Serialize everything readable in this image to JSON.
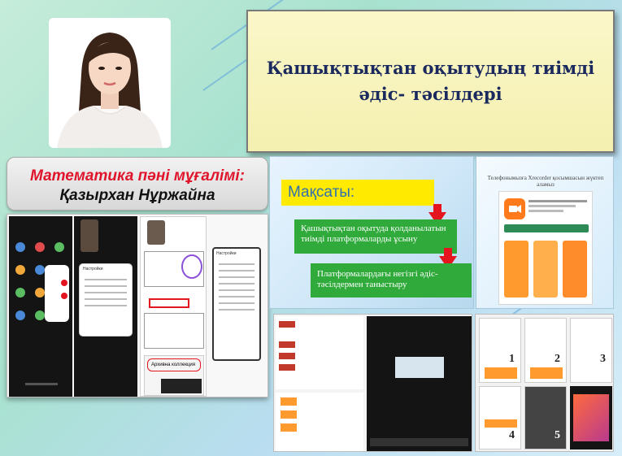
{
  "slide": {
    "title": "Қашықтықтан оқытудың тиімді әдіс- тәсілдері"
  },
  "teacher": {
    "role": "Математика пәні мұғалімі:",
    "name": "Қазырхан Нұржайна"
  },
  "goals_slide": {
    "heading": "Мақсаты:",
    "goals": [
      "Қашықтықтан оқытуда қолданылатын тиімді платформаларды ұсыну",
      "Платформалардағы негізгі әдіс-тәсілдермен   таныстыру"
    ]
  },
  "xrecorder_slide": {
    "caption": "Телефонымызға Xrecorder қосымшасын жүктеп аламыз"
  },
  "steps": {
    "labels": [
      "1",
      "2",
      "3",
      "4",
      "5"
    ]
  },
  "left_shots": {
    "settings_title": "Настройки",
    "banner_text": "Архивна коллекция"
  },
  "colors": {
    "title_text": "#1b2a5e",
    "role_text": "#e0142b",
    "goal_green": "#2faa3b",
    "heading_yellow": "#ffea00",
    "arrow_red": "#e5151f",
    "accent_orange": "#ff9a2e"
  }
}
